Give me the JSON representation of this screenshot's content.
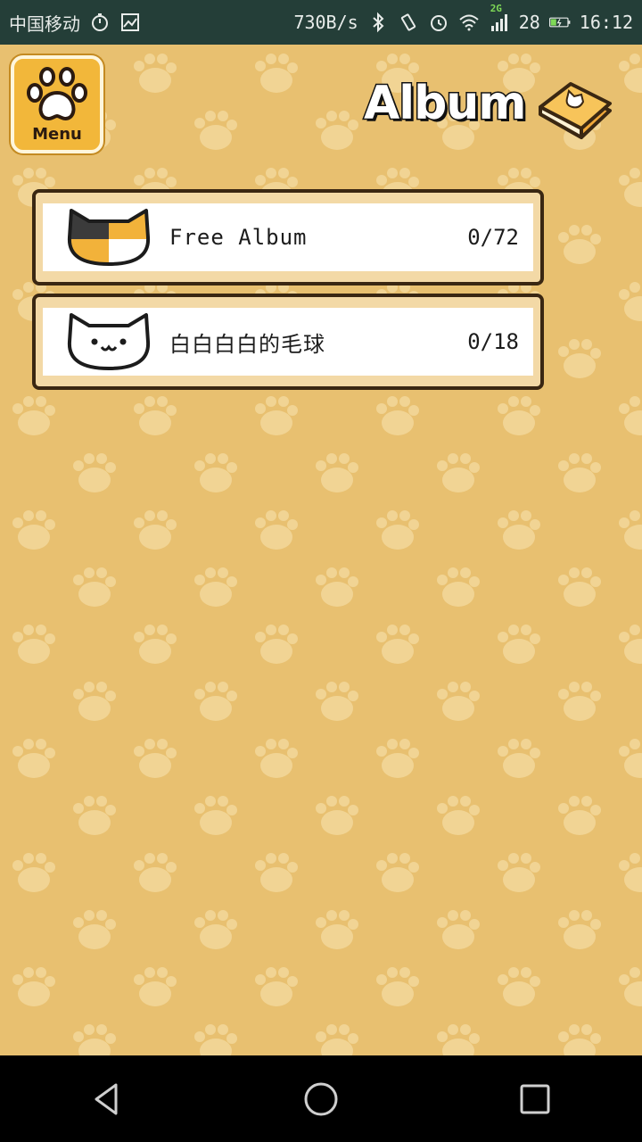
{
  "status_bar": {
    "carrier": "中国移动",
    "net_speed": "730B/s",
    "network_type": "2G",
    "battery_percent": "28",
    "time": "16:12"
  },
  "header": {
    "menu_label": "Menu",
    "title": "Album"
  },
  "albums": [
    {
      "name": "Free Album",
      "count": "0/72",
      "icon": "calico-cat-icon"
    },
    {
      "name": "白白白白的毛球",
      "count": "0/18",
      "icon": "white-cat-icon"
    }
  ],
  "colors": {
    "background": "#e8c070",
    "paw_pattern": "#f1d494",
    "menu_button": "#f2b73a",
    "status_bar": "#243e38",
    "card_border": "#3a2712",
    "card_fill": "#f3d9a6"
  }
}
